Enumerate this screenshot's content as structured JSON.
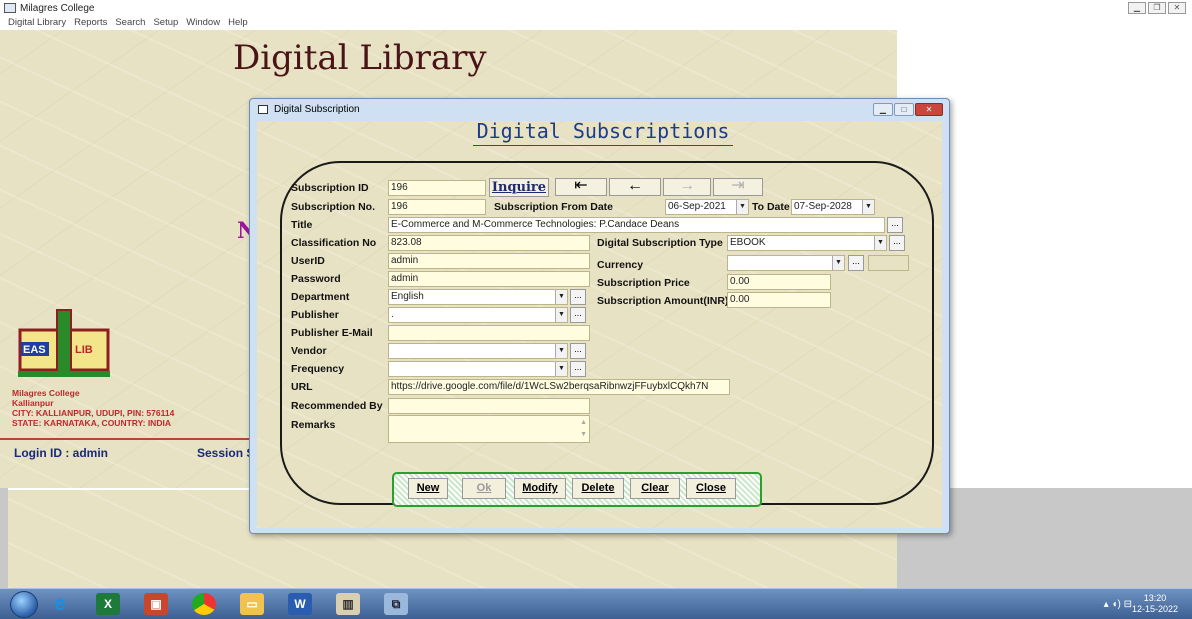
{
  "window": {
    "title": "Milagres College"
  },
  "menu": [
    "Digital Library",
    "Reports",
    "Search",
    "Setup",
    "Window",
    "Help"
  ],
  "background": {
    "title": "Digital Library",
    "letter": "N",
    "logo_text": "EASYLIB",
    "college": [
      "Milagres College",
      "Kallianpur",
      "CITY: KALLIANPUR, UDUPI, PIN: 576114",
      "STATE: KARNATAKA, COUNTRY: INDIA"
    ],
    "login": "Login ID : admin",
    "session": "Session S"
  },
  "dialog": {
    "title": "Digital Subscription",
    "heading": "Digital Subscriptions",
    "inquire": "Inquire",
    "labels": {
      "subscription_id": "Subscription ID",
      "subscription_no": "Subscription No.",
      "from_date": "Subscription From Date",
      "to_date": "To Date",
      "title": "Title",
      "classification": "Classification No",
      "userid": "UserID",
      "password": "Password",
      "department": "Department",
      "publisher": "Publisher",
      "publisher_email": "Publisher E-Mail",
      "vendor": "Vendor",
      "frequency": "Frequency",
      "url": "URL",
      "recommended_by": "Recommended By",
      "remarks": "Remarks",
      "ds_type": "Digital Subscription Type",
      "currency": "Currency",
      "price": "Subscription Price",
      "amount": "Subscription Amount(INR)"
    },
    "values": {
      "subscription_id": "196",
      "subscription_no": "196",
      "from_date": "06-Sep-2021",
      "to_date": "07-Sep-2028",
      "title": "E-Commerce and M-Commerce Technologies: P.Candace Deans",
      "classification": "823.08",
      "userid": "admin",
      "password": "admin",
      "department": "English",
      "publisher": ".",
      "url": "https://drive.google.com/file/d/1WcLSw2berqsaRibnwzjFFuybxlCQkh7N",
      "ds_type": "EBOOK",
      "price": "0.00",
      "amount": "0.00"
    },
    "buttons": [
      "New",
      "Ok",
      "Modify",
      "Delete",
      "Clear",
      "Close"
    ]
  },
  "taskbar": {
    "time": "13:20",
    "date": "12-15-2022"
  }
}
